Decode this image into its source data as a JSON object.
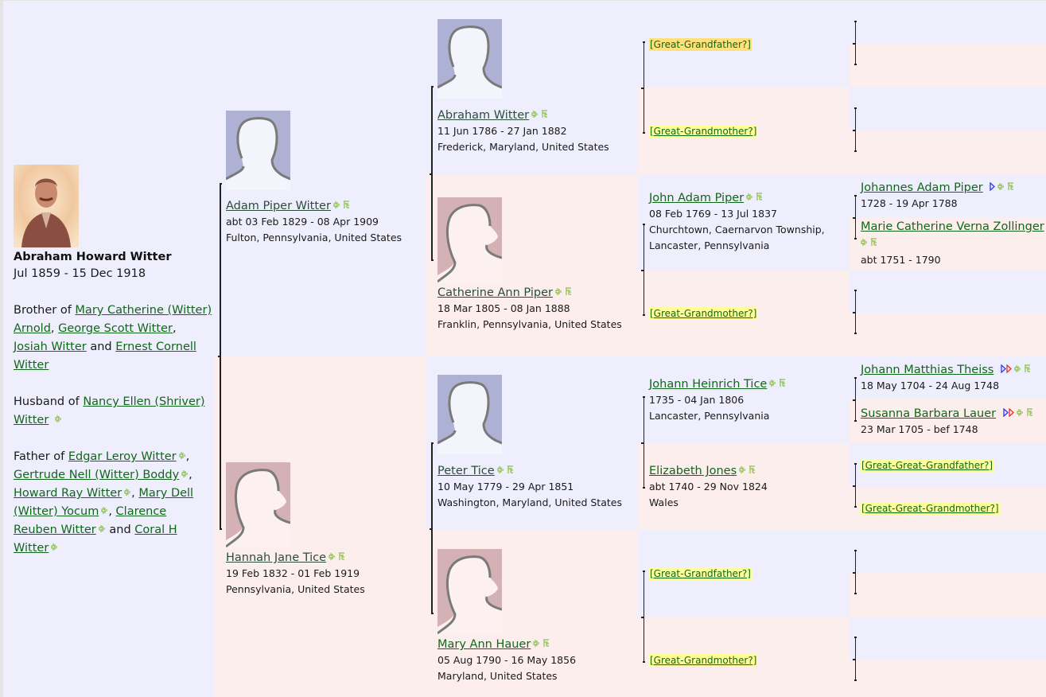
{
  "root": {
    "name": "Abraham Howard Witter",
    "dates": "Jul 1859 - 15 Dec 1918",
    "brother_prefix": "Brother of",
    "siblings": [
      "Mary Catherine (Witter) Arnold",
      "George Scott Witter",
      "Josiah Witter",
      "Ernest Cornell Witter"
    ],
    "husband_prefix": "Husband of",
    "spouse": "Nancy Ellen (Shriver) Witter",
    "father_prefix": "Father of",
    "children": [
      "Edgar Leroy Witter",
      "Gertrude Nell (Witter) Boddy",
      "Howard Ray Witter",
      "Mary Dell (Witter) Yocum",
      "Clarence Reuben Witter",
      "Coral H Witter"
    ],
    "and": "and",
    "comma": ","
  },
  "parents": {
    "father": {
      "name": "Adam Piper Witter",
      "dates": "abt 03 Feb 1829 - 08 Apr 1909",
      "place": "Fulton, Pennsylvania, United States"
    },
    "mother": {
      "name": "Hannah Jane Tice",
      "dates": "19 Feb 1832 - 01 Feb 1919",
      "place": "Pennsylvania, United States"
    }
  },
  "grandparents": [
    {
      "name": "Abraham Witter",
      "dates": "11 Jun 1786 - 27 Jan 1882",
      "place": "Frederick, Maryland, United States"
    },
    {
      "name": "Catherine Ann Piper",
      "dates": "18 Mar 1805 - 08 Jan 1888",
      "place": "Franklin, Pennsylvania, United States"
    },
    {
      "name": "Peter Tice",
      "dates": "10 May 1779 - 29 Apr 1851",
      "place": "Washington, Maryland, United States"
    },
    {
      "name": "Mary Ann Hauer",
      "dates": "05 Aug 1790 - 16 May 1856",
      "place": "Maryland, United States"
    }
  ],
  "great_grandparents": [
    {
      "unknown": "[Great-Grandfather?]"
    },
    {
      "unknown": "[Great-Grandmother?]"
    },
    {
      "name": "John Adam Piper",
      "dates": "08 Feb 1769 - 13 Jul 1837",
      "place1": "Churchtown, Caernarvon Township,",
      "place2": "Lancaster, Pennsylvania"
    },
    {
      "unknown": "[Great-Grandmother?]"
    },
    {
      "name": "Johann Heinrich Tice",
      "dates": "1735 - 04 Jan 1806",
      "place": "Lancaster, Pennsylvania"
    },
    {
      "name": "Elizabeth Jones",
      "dates": "abt 1740 - 29 Nov 1824",
      "place": "Wales"
    },
    {
      "unknown": "[Great-Grandfather?]"
    },
    {
      "unknown": "[Great-Grandmother?]"
    }
  ],
  "gg_grandparents": {
    "johannes": {
      "name": "Johannes Adam Piper",
      "dates": "1728 - 19 Apr 1788"
    },
    "marie": {
      "name": "Marie Catherine Verna Zollinger",
      "dates": "abt 1751 - 1790"
    },
    "johann_matthias": {
      "name": "Johann Matthias Theiss",
      "dates": "18 May 1704 - 24 Aug 1748"
    },
    "susanna": {
      "name": "Susanna Barbara Lauer",
      "dates": "23 Mar 1705 - bef 1748"
    },
    "unknown_gf": "[Great-Great-Grandfather?]",
    "unknown_gm": "[Great-Great-Grandmother?]"
  },
  "icons": {
    "family": "family-group-icon",
    "descendants": "descendants-tree-icon",
    "more_ancestors": "more-ancestors-arrow-icon"
  },
  "colors": {
    "male_bg": "#eeeefd",
    "female_bg": "#fdeeee",
    "link": "#12661a",
    "unknown_highlight": "#ffff99",
    "icon_green": "#8cc04a",
    "arrow_blue": "#2b3af0",
    "arrow_red": "#f02b2b"
  }
}
